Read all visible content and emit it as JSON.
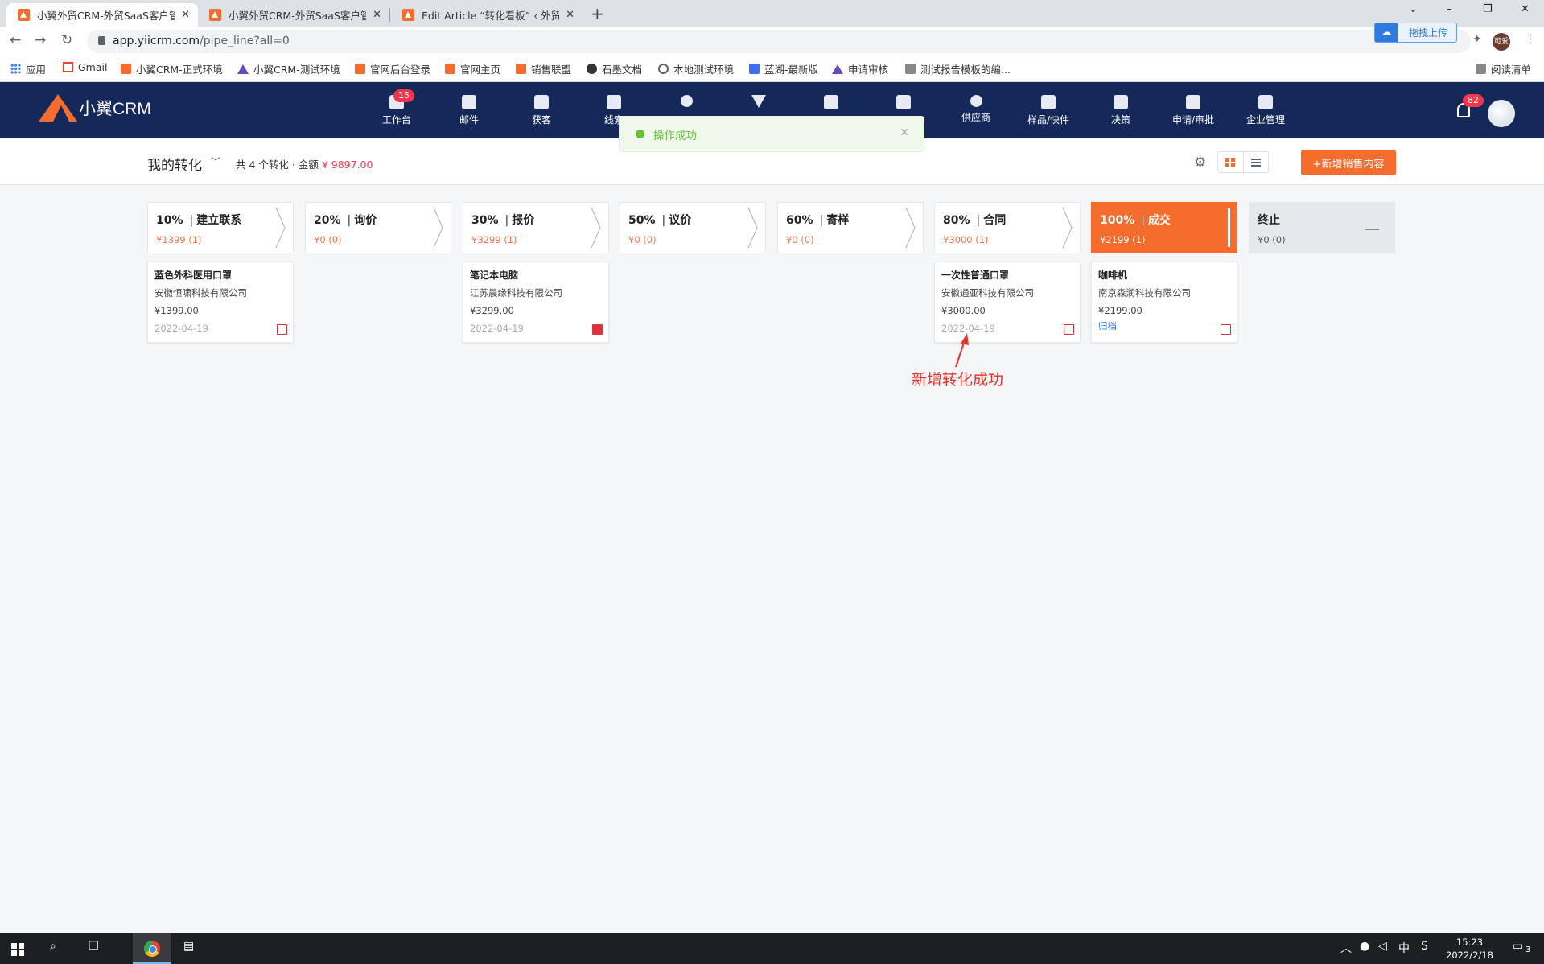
{
  "browser": {
    "tabs": [
      {
        "title": "小翼外贸CRM-外贸SaaS客户管理",
        "active": true
      },
      {
        "title": "小翼外贸CRM-外贸SaaS客户管理",
        "active": false
      },
      {
        "title": "Edit Article “转化看板” ‹ 外贸CR",
        "active": false
      }
    ],
    "new_tab": "+",
    "close": "✕",
    "url_host": "app.yiicrm.com",
    "url_path": "/pipe_line?all=0",
    "upload_label": "拖拽上传",
    "profile_label": "可爱",
    "bookmarks": [
      {
        "label": "应用",
        "icon": "apps-icon"
      },
      {
        "label": "Gmail",
        "icon": "gmail-icon"
      },
      {
        "label": "小翼CRM-正式环境",
        "icon": "crm-icon"
      },
      {
        "label": "小翼CRM-测试环境",
        "icon": "triangle-icon"
      },
      {
        "label": "官网后台登录",
        "icon": "crm-icon"
      },
      {
        "label": "官网主页",
        "icon": "crm-icon"
      },
      {
        "label": "销售联盟",
        "icon": "crm-icon"
      },
      {
        "label": "石墨文档",
        "icon": "shimo-icon"
      },
      {
        "label": "本地测试环境",
        "icon": "globe-icon"
      },
      {
        "label": "蓝湖-最新版",
        "icon": "lanhu-icon"
      },
      {
        "label": "申请审核",
        "icon": "triangle-icon"
      },
      {
        "label": "测试报告模板的编...",
        "icon": "doc-icon"
      }
    ],
    "reading_list": "阅读清单"
  },
  "app": {
    "logo_text": "小翼CRM",
    "nav": [
      {
        "label": "工作台",
        "icon": "dashboard-icon",
        "badge": "15"
      },
      {
        "label": "邮件",
        "icon": "mail-icon"
      },
      {
        "label": "获客",
        "icon": "acquire-icon"
      },
      {
        "label": "线索",
        "icon": "leads-icon"
      },
      {
        "label": "",
        "icon": "contact-icon"
      },
      {
        "label": "",
        "icon": "funnel-icon"
      },
      {
        "label": "",
        "icon": "clipboard-icon"
      },
      {
        "label": "",
        "icon": "briefcase-icon"
      },
      {
        "label": "供应商",
        "icon": "supplier-icon"
      },
      {
        "label": "样品/快件",
        "icon": "flask-icon"
      },
      {
        "label": "决策",
        "icon": "chart-icon"
      },
      {
        "label": "申请/审批",
        "icon": "approval-icon"
      },
      {
        "label": "企业管理",
        "icon": "building-icon"
      }
    ],
    "notify_badge": "82"
  },
  "toast": {
    "text": "操作成功"
  },
  "subheader": {
    "title": "我的转化",
    "summary_prefix": "共 4 个转化 · 金额",
    "summary_amount": "¥ 9897.00",
    "add_button": "+新增销售内容"
  },
  "pipeline": {
    "stages": [
      {
        "pct": "10%",
        "name": "建立联系",
        "amount": "¥1399 (1)"
      },
      {
        "pct": "20%",
        "name": "询价",
        "amount": "¥0 (0)"
      },
      {
        "pct": "30%",
        "name": "报价",
        "amount": "¥3299 (1)"
      },
      {
        "pct": "50%",
        "name": "议价",
        "amount": "¥0 (0)"
      },
      {
        "pct": "60%",
        "name": "寄样",
        "amount": "¥0 (0)"
      },
      {
        "pct": "80%",
        "name": "合同",
        "amount": "¥3000 (1)"
      },
      {
        "pct": "100%",
        "name": "成交",
        "amount": "¥2199 (1)"
      },
      {
        "pct": "终止",
        "name": "",
        "amount": "¥0 (0)"
      }
    ],
    "cards": [
      {
        "title": "蓝色外科医用口罩",
        "company": "安徽恒啸科技有限公司",
        "amount": "¥1399.00",
        "date": "2022-04-19"
      },
      {
        "title": "笔记本电脑",
        "company": "江苏晨缘科技有限公司",
        "amount": "¥3299.00",
        "date": "2022-04-19"
      },
      {
        "title": "一次性普通口罩",
        "company": "安徽通亚科技有限公司",
        "amount": "¥3000.00",
        "date": "2022-04-19"
      },
      {
        "title": "咖啡机",
        "company": "南京森润科技有限公司",
        "amount": "¥2199.00",
        "link": "归档"
      }
    ]
  },
  "annotation": {
    "text": "新增转化成功"
  },
  "taskbar": {
    "ime": "中",
    "time": "15:23",
    "date": "2022/2/18",
    "notif_count": "3"
  },
  "colors": {
    "accent": "#f56c2d",
    "header_bg": "#14285a",
    "success": "#67c23a",
    "danger": "#f5364a"
  }
}
